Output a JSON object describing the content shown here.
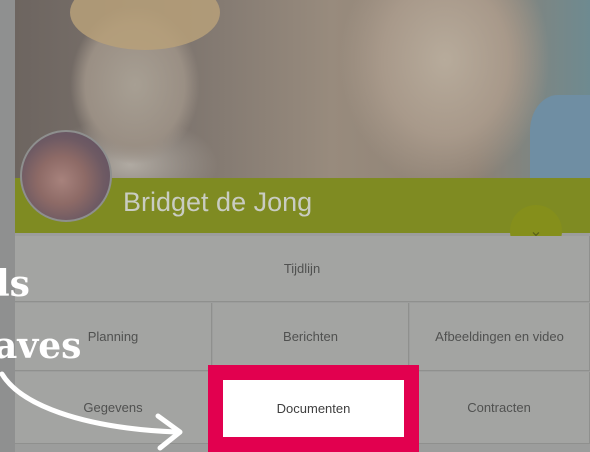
{
  "profile": {
    "name": "Bridget de Jong",
    "expand_icon": "chevron-down-icon"
  },
  "tabs": {
    "tijdlijn": "Tijdlijn",
    "planning": "Planning",
    "berichten": "Berichten",
    "afbeeldingen": "Afbeeldingen en video",
    "gegevens": "Gegevens",
    "documenten": "Documenten",
    "contracten": "Contracten"
  },
  "overlay": {
    "line1": "ls",
    "line2": "aves"
  },
  "colors": {
    "accent": "#a7c02a",
    "highlight": "#e2004f"
  }
}
